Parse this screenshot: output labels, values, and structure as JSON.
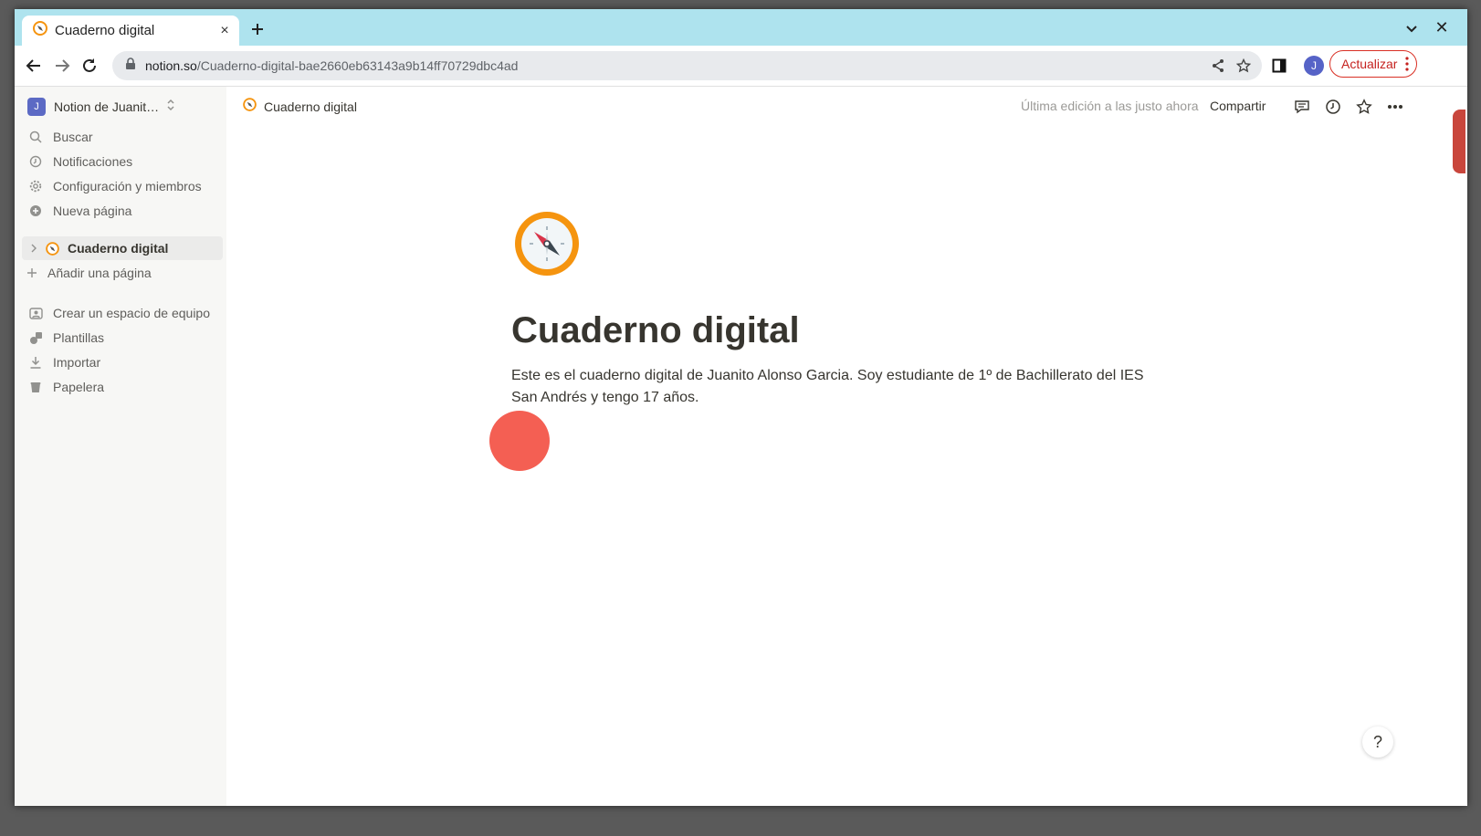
{
  "browser": {
    "tab": {
      "title": "Cuaderno digital",
      "close_label": "×"
    },
    "new_tab_label": "+",
    "window_close_label": "✕",
    "url": {
      "host": "notion.so",
      "path": "/Cuaderno-digital-bae2660eb63143a9b14ff70729dbc4ad"
    },
    "profile_initial": "J",
    "update_label": "Actualizar"
  },
  "sidebar": {
    "workspace_initial": "J",
    "workspace_name": "Notion de Juanit…",
    "items": [
      {
        "label": "Buscar",
        "icon": "search-icon"
      },
      {
        "label": "Notificaciones",
        "icon": "clock-icon"
      },
      {
        "label": "Configuración y miembros",
        "icon": "gear-icon"
      },
      {
        "label": "Nueva página",
        "icon": "plus-circle-icon"
      }
    ],
    "page": {
      "label": "Cuaderno digital",
      "icon": "compass-icon"
    },
    "add_page_label": "Añadir una página",
    "bottom_items": [
      {
        "label": "Crear un espacio de equipo",
        "icon": "team-space-icon"
      },
      {
        "label": "Plantillas",
        "icon": "shapes-icon"
      },
      {
        "label": "Importar",
        "icon": "download-icon"
      },
      {
        "label": "Papelera",
        "icon": "trash-icon"
      }
    ]
  },
  "header": {
    "breadcrumb": "Cuaderno digital",
    "edited": "Última edición a las justo ahora",
    "share_label": "Compartir"
  },
  "page": {
    "title": "Cuaderno digital",
    "body": "Este es el cuaderno digital de Juanito Alonso Garcia. Soy estudiante de 1º de Bachillerato del IES San Andrés y tengo 17 años."
  },
  "help_label": "?",
  "colors": {
    "tabstrip": "#aee3ee",
    "sidebar_bg": "#f7f7f5",
    "accent_orange": "#f5940f",
    "click_marker": "#f45f53",
    "update_red": "#d93025"
  }
}
